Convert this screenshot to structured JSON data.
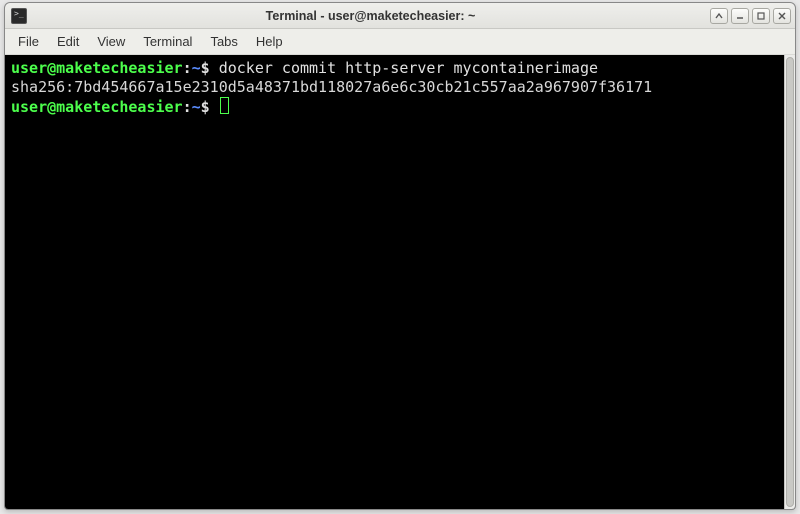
{
  "window": {
    "title": "Terminal - user@maketecheasier: ~"
  },
  "menu": {
    "items": [
      "File",
      "Edit",
      "View",
      "Terminal",
      "Tabs",
      "Help"
    ]
  },
  "terminal": {
    "lines": [
      {
        "type": "prompt",
        "user_host": "user@maketecheasier",
        "sep": ":",
        "path": "~",
        "suffix": "$ ",
        "command": "docker commit http-server mycontainerimage"
      },
      {
        "type": "output",
        "text": "sha256:7bd454667a15e2310d5a48371bd118027a6e6c30cb21c557aa2a967907f36171"
      },
      {
        "type": "prompt",
        "user_host": "user@maketecheasier",
        "sep": ":",
        "path": "~",
        "suffix": "$ ",
        "command": "",
        "cursor": true
      }
    ]
  }
}
